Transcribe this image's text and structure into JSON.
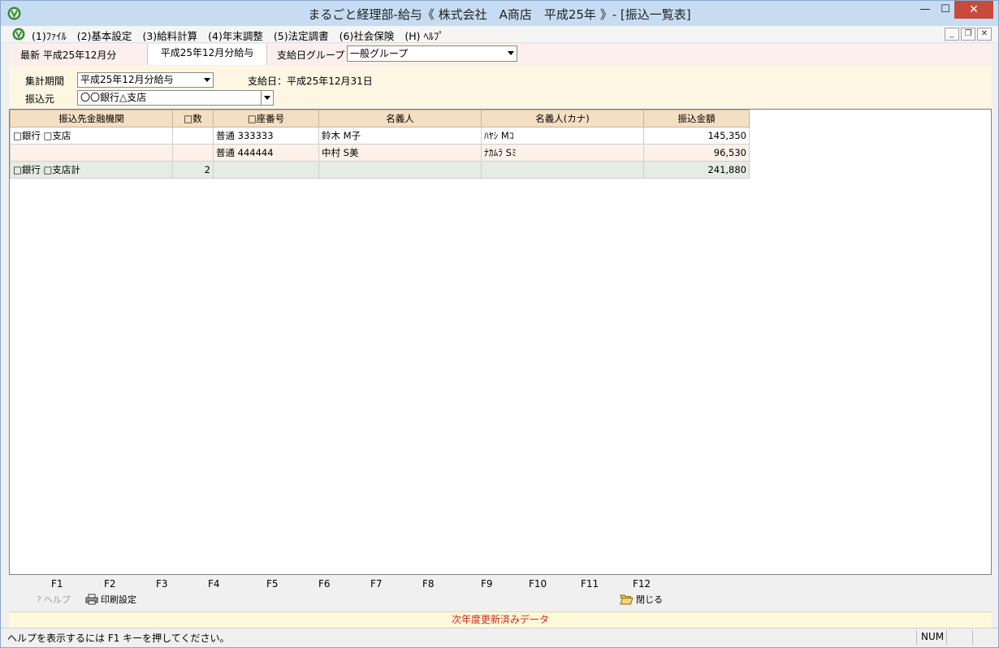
{
  "window": {
    "title": "まるごと経理部-給与《 株式会社　A商店　平成25年 》- [振込一覧表]",
    "min_glyph": "—",
    "max_glyph": "☐",
    "close_glyph": "✕"
  },
  "menu": {
    "items": [
      "(1)ﾌｧｲﾙ",
      "(2)基本設定",
      "(3)給料計算",
      "(4)年末調整",
      "(5)法定調書",
      "(6)社会保険",
      "(H) ﾍﾙﾌﾟ"
    ],
    "mdi_min": "_",
    "mdi_restore": "❐",
    "mdi_close": "✕"
  },
  "tabs": {
    "latest_label": "最新 平成25年12月分",
    "active_label": "平成25年12月分給与",
    "group_label": "支給日グループ",
    "group_value": "一般グループ"
  },
  "filters": {
    "period_label": "集計期間",
    "period_value": "平成25年12月分給与",
    "payday_text": "支給日：平成25年12月31日",
    "source_label": "振込元",
    "source_value": "〇〇銀行△支店"
  },
  "grid": {
    "headers": [
      "振込先金融機関",
      "□数",
      "□座番号",
      "名義人",
      "名義人(カナ)",
      "振込金額"
    ],
    "rows": [
      {
        "bank": "□銀行 □支店",
        "count": "",
        "account": "普通 333333",
        "name": "鈴木 M子",
        "kana": "ﾊﾔｼ Mｺ",
        "amount": "145,350"
      },
      {
        "bank": "",
        "count": "",
        "account": "普通 444444",
        "name": "中村 S美",
        "kana": "ﾅｶﾑﾗ Sﾐ",
        "amount": "96,530"
      }
    ],
    "subtotal": {
      "bank": "□銀行 □支店計",
      "count": "2",
      "account": "",
      "name": "",
      "kana": "",
      "amount": "241,880"
    }
  },
  "fkeys": {
    "keys": [
      "F1",
      "F2",
      "F3",
      "F4",
      "F5",
      "F6",
      "F7",
      "F8",
      "F9",
      "F10",
      "F11",
      "F12"
    ],
    "help_label": "ヘルプ",
    "print_label": "印刷設定",
    "close_label": "閉じる"
  },
  "notice": "次年度更新済みデータ",
  "status": {
    "message": "ヘルプを表示するには F1 キーを押してください。",
    "num": "NUM"
  },
  "colors": {
    "titlebar": "#c6dcf2",
    "close_button": "#c84a3f",
    "header_bg": "#f5dfc3",
    "notice_text": "#cc2a1a"
  }
}
